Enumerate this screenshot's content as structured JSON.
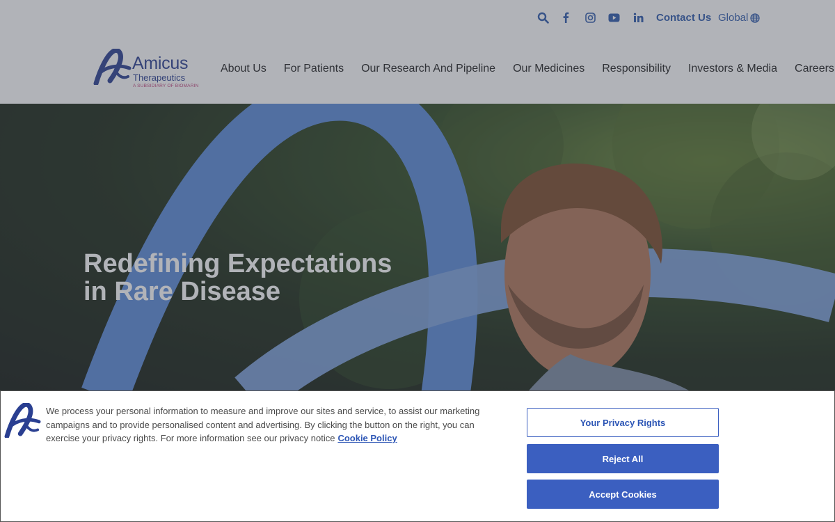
{
  "header": {
    "utility": {
      "icons": [
        "search-icon",
        "facebook-icon",
        "instagram-icon",
        "youtube-icon",
        "linkedin-icon"
      ],
      "contact_label": "Contact Us",
      "global_label": "Global",
      "globe_icon": "globe-icon"
    },
    "logo": {
      "name": "Amicus",
      "sub": "Therapeutics",
      "tagline": "A SUBSIDIARY OF BIOMARIN"
    },
    "nav": [
      {
        "label": "About Us"
      },
      {
        "label": "For Patients"
      },
      {
        "label": "Our Research And Pipeline"
      },
      {
        "label": "Our Medicines"
      },
      {
        "label": "Responsibility"
      },
      {
        "label": "Investors & Media"
      },
      {
        "label": "Careers"
      }
    ]
  },
  "hero": {
    "headline_line1": "Redefining Expectations",
    "headline_line2": "in Rare Disease"
  },
  "cookie_banner": {
    "text": "We process your personal information to measure and improve our sites and service, to assist our marketing campaigns and to provide personalised content and advertising. By clicking the button on the right, you can exercise your privacy rights. For more information see our privacy notice",
    "policy_link": "Cookie Policy",
    "privacy_button": "Your Privacy Rights",
    "reject_button": "Reject All",
    "accept_button": "Accept Cookies"
  },
  "colors": {
    "brand_blue": "#2a3f91",
    "link_blue": "#2e5aac",
    "button_blue": "#3b5fc0",
    "tagline_pink": "#c0407a"
  }
}
